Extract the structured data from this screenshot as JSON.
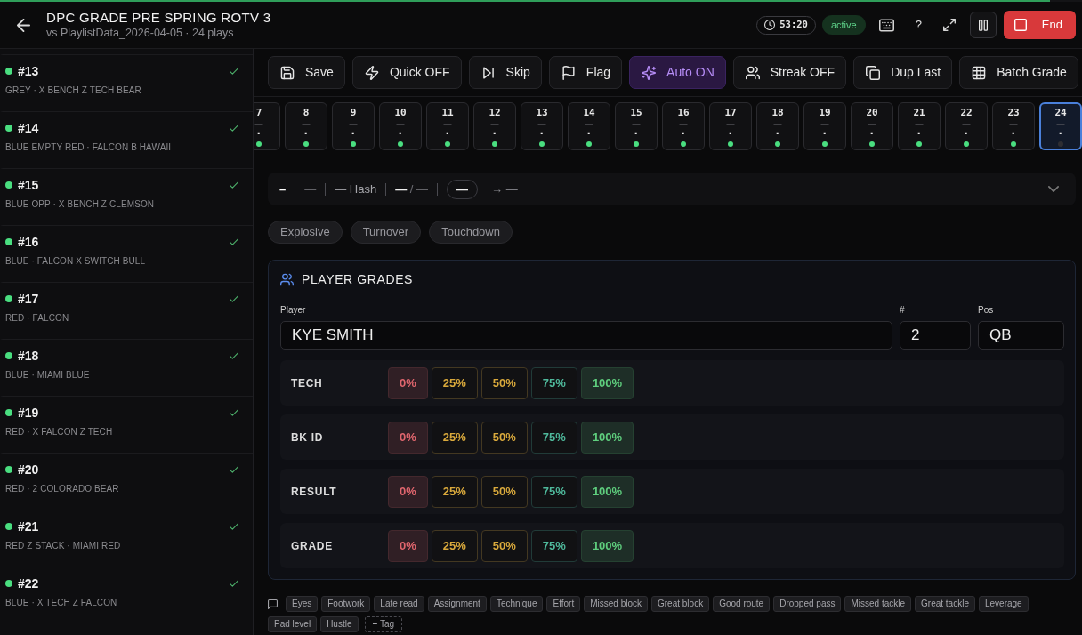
{
  "progress": {
    "level": 0.97
  },
  "header": {
    "title": "DPC GRADE PRE SPRING ROTV 3",
    "subtitle": "vs PlaylistData_2026-04-05 · 24 plays",
    "timer": "53:20",
    "status": "active",
    "help": "?",
    "end_label": "End"
  },
  "sidebar": {
    "items": [
      {
        "number": "#13",
        "description": "GREY · X BENCH Z TECH BEAR",
        "graded": true,
        "selected": false
      },
      {
        "number": "#14",
        "description": "BLUE EMPTY RED · FALCON B HAWAII",
        "graded": true,
        "selected": false
      },
      {
        "number": "#15",
        "description": "BLUE OPP · X BENCH Z CLEMSON",
        "graded": true,
        "selected": false
      },
      {
        "number": "#16",
        "description": "BLUE · FALCON X SWITCH BULL",
        "graded": true,
        "selected": false
      },
      {
        "number": "#17",
        "description": "RED · FALCON",
        "graded": true,
        "selected": false
      },
      {
        "number": "#18",
        "description": "BLUE · MIAMI BLUE",
        "graded": true,
        "selected": false
      },
      {
        "number": "#19",
        "description": "RED · X FALCON Z TECH",
        "graded": true,
        "selected": false
      },
      {
        "number": "#20",
        "description": "RED · 2 COLORADO BEAR",
        "graded": true,
        "selected": false
      },
      {
        "number": "#21",
        "description": "RED Z STACK · MIAMI RED",
        "graded": true,
        "selected": false
      },
      {
        "number": "#22",
        "description": "BLUE · X TECH Z FALCON",
        "graded": true,
        "selected": false
      }
    ]
  },
  "toolbar": {
    "buttons": [
      {
        "label": "Save",
        "on": false
      },
      {
        "label": "Quick OFF",
        "on": false
      },
      {
        "label": "Skip",
        "on": false
      },
      {
        "label": "Flag",
        "on": false
      },
      {
        "label": "Auto ON",
        "on": true
      },
      {
        "label": "Streak OFF",
        "on": false
      },
      {
        "label": "Dup Last",
        "on": false
      },
      {
        "label": "Batch Grade",
        "on": false
      }
    ]
  },
  "plays": [
    {
      "number": "7",
      "line_2": "—",
      "line_3": "·",
      "graded": true,
      "selected": false
    },
    {
      "number": "8",
      "line_2": "—",
      "line_3": "·",
      "graded": true,
      "selected": false
    },
    {
      "number": "9",
      "line_2": "—",
      "line_3": "·",
      "graded": true,
      "selected": false
    },
    {
      "number": "10",
      "line_2": "—",
      "line_3": "·",
      "graded": true,
      "selected": false
    },
    {
      "number": "11",
      "line_2": "—",
      "line_3": "·",
      "graded": true,
      "selected": false
    },
    {
      "number": "12",
      "line_2": "—",
      "line_3": "·",
      "graded": true,
      "selected": false
    },
    {
      "number": "13",
      "line_2": "—",
      "line_3": "·",
      "graded": true,
      "selected": false
    },
    {
      "number": "14",
      "line_2": "—",
      "line_3": "·",
      "graded": true,
      "selected": false
    },
    {
      "number": "15",
      "line_2": "—",
      "line_3": "·",
      "graded": true,
      "selected": false
    },
    {
      "number": "16",
      "line_2": "—",
      "line_3": "·",
      "graded": true,
      "selected": false
    },
    {
      "number": "17",
      "line_2": "—",
      "line_3": "·",
      "graded": true,
      "selected": false
    },
    {
      "number": "18",
      "line_2": "—",
      "line_3": "·",
      "graded": true,
      "selected": false
    },
    {
      "number": "19",
      "line_2": "—",
      "line_3": "·",
      "graded": true,
      "selected": false
    },
    {
      "number": "20",
      "line_2": "—",
      "line_3": "·",
      "graded": true,
      "selected": false
    },
    {
      "number": "21",
      "line_2": "—",
      "line_3": "·",
      "graded": true,
      "selected": false
    },
    {
      "number": "22",
      "line_2": "—",
      "line_3": "·",
      "graded": true,
      "selected": false
    },
    {
      "number": "23",
      "line_2": "—",
      "line_3": "·",
      "graded": true,
      "selected": false
    },
    {
      "number": "24",
      "line_2": "—",
      "line_3": "·",
      "graded": false,
      "selected": true
    }
  ],
  "situation": {
    "segments": [
      {
        "text": "–",
        "kind": "strong"
      },
      {
        "text": "—",
        "kind": "muted"
      },
      {
        "text": "— Hash",
        "kind": "plain"
      },
      {
        "text": "**—** / —",
        "kind": "muted"
      }
    ],
    "pill": "—",
    "result": "→ —"
  },
  "quick_tags": [
    {
      "label": "Explosive",
      "selected": false
    },
    {
      "label": "Turnover",
      "selected": false
    },
    {
      "label": "Touchdown",
      "selected": false
    }
  ],
  "player_grades": {
    "title": "PLAYER GRADES",
    "fields": [
      {
        "label": "Player",
        "value": "KYE SMITH"
      },
      {
        "label": "#",
        "value": "2"
      },
      {
        "label": "Pos",
        "value": "QB"
      }
    ],
    "rows": [
      {
        "label": "TECH",
        "options": [
          {
            "label": "0%",
            "color": "#e0666e",
            "tinted": true,
            "selected": false
          },
          {
            "label": "25%",
            "color": "#d9a93c",
            "tinted": false,
            "selected": false
          },
          {
            "label": "50%",
            "color": "#d9a93c",
            "tinted": false,
            "selected": false
          },
          {
            "label": "75%",
            "color": "#4fb89b",
            "tinted": false,
            "selected": false
          },
          {
            "label": "100%",
            "color": "#5fcf7e",
            "tinted": true,
            "selected": false
          }
        ]
      },
      {
        "label": "BK ID",
        "options": [
          {
            "label": "0%",
            "color": "#e0666e",
            "tinted": true,
            "selected": false
          },
          {
            "label": "25%",
            "color": "#d9a93c",
            "tinted": false,
            "selected": false
          },
          {
            "label": "50%",
            "color": "#d9a93c",
            "tinted": false,
            "selected": false
          },
          {
            "label": "75%",
            "color": "#4fb89b",
            "tinted": false,
            "selected": false
          },
          {
            "label": "100%",
            "color": "#5fcf7e",
            "tinted": true,
            "selected": false
          }
        ]
      },
      {
        "label": "RESULT",
        "options": [
          {
            "label": "0%",
            "color": "#e0666e",
            "tinted": true,
            "selected": false
          },
          {
            "label": "25%",
            "color": "#d9a93c",
            "tinted": false,
            "selected": false
          },
          {
            "label": "50%",
            "color": "#d9a93c",
            "tinted": false,
            "selected": false
          },
          {
            "label": "75%",
            "color": "#4fb89b",
            "tinted": false,
            "selected": false
          },
          {
            "label": "100%",
            "color": "#5fcf7e",
            "tinted": true,
            "selected": false
          }
        ]
      },
      {
        "label": "GRADE",
        "options": [
          {
            "label": "0%",
            "color": "#e0666e",
            "tinted": true,
            "selected": false
          },
          {
            "label": "25%",
            "color": "#d9a93c",
            "tinted": false,
            "selected": false
          },
          {
            "label": "50%",
            "color": "#d9a93c",
            "tinted": false,
            "selected": false
          },
          {
            "label": "75%",
            "color": "#4fb89b",
            "tinted": false,
            "selected": false
          },
          {
            "label": "100%",
            "color": "#5fcf7e",
            "tinted": true,
            "selected": false
          }
        ]
      }
    ]
  },
  "note_tags": {
    "tags": [
      {
        "label": "Eyes",
        "selected": false
      },
      {
        "label": "Footwork",
        "selected": false
      },
      {
        "label": "Late read",
        "selected": false
      },
      {
        "label": "Assignment",
        "selected": false
      },
      {
        "label": "Technique",
        "selected": false
      },
      {
        "label": "Effort",
        "selected": false
      },
      {
        "label": "Missed block",
        "selected": false
      },
      {
        "label": "Great block",
        "selected": false
      },
      {
        "label": "Good route",
        "selected": false
      },
      {
        "label": "Dropped pass",
        "selected": false
      },
      {
        "label": "Missed tackle",
        "selected": false
      },
      {
        "label": "Great tackle",
        "selected": false
      },
      {
        "label": "Leverage",
        "selected": false
      },
      {
        "label": "Pad level",
        "selected": false
      },
      {
        "label": "Hustle",
        "selected": false
      }
    ],
    "add_label": "+ Tag"
  }
}
